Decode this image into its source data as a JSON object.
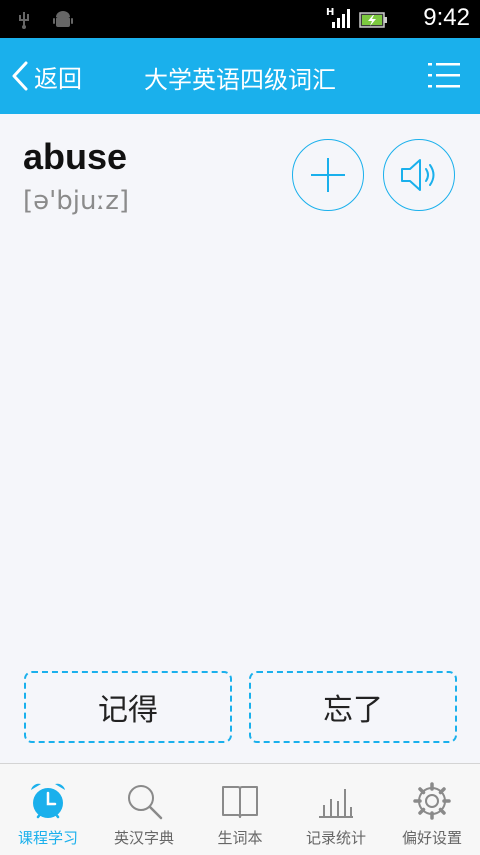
{
  "status_bar": {
    "time": "9:42",
    "network": "H"
  },
  "nav": {
    "back_label": "返回",
    "title": "大学英语四级词汇"
  },
  "word": {
    "text": "abuse",
    "phonetic": "[ə'bjuːz]"
  },
  "actions": {
    "remember_label": "记得",
    "forgot_label": "忘了"
  },
  "tabs": [
    {
      "label": "课程学习",
      "icon": "alarm-clock-icon",
      "active": true
    },
    {
      "label": "英汉字典",
      "icon": "search-icon",
      "active": false
    },
    {
      "label": "生词本",
      "icon": "book-icon",
      "active": false
    },
    {
      "label": "记录统计",
      "icon": "bar-chart-icon",
      "active": false
    },
    {
      "label": "偏好设置",
      "icon": "gear-icon",
      "active": false
    }
  ],
  "colors": {
    "accent": "#1ab0ec",
    "background": "#f5f6fa"
  }
}
